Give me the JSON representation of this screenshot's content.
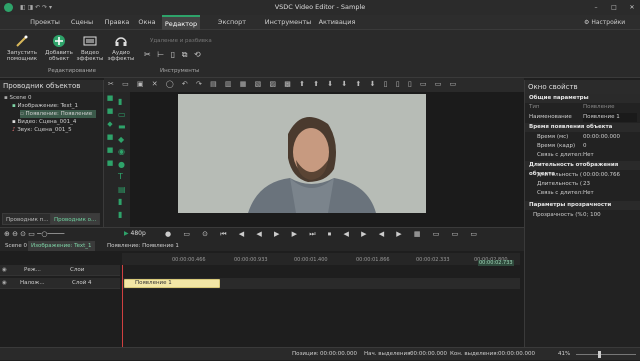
{
  "window": {
    "title": "VSDC Video Editor - Sample",
    "settings_label": "Настройки"
  },
  "menu": [
    {
      "label": "Проекты"
    },
    {
      "label": "Сцены"
    },
    {
      "label": "Правка"
    },
    {
      "label": "Окна"
    },
    {
      "label": "Редактор"
    },
    {
      "label": "Экспорт проекта"
    },
    {
      "label": "Инструменты"
    },
    {
      "label": "Активация"
    }
  ],
  "ribbon": {
    "launch_wizard": "Запустить помощник",
    "add_object": "Добавить объект",
    "video_effects": "Видео эффекты",
    "audio_effects": "Аудио эффекты",
    "group_editing": "Редактирование",
    "tools_label": "Удаление и разбивка",
    "group_tools": "Инструменты"
  },
  "explorer": {
    "title": "Проводник объектов",
    "items": [
      {
        "label": "Scene 0"
      },
      {
        "label": "Изображение: Text_1"
      },
      {
        "label": "Появление: Появление"
      },
      {
        "label": "Видео: Сцена_001_4"
      },
      {
        "label": "Звук: Сцена_001_5"
      }
    ],
    "tabs": [
      {
        "label": "Проводник п..."
      },
      {
        "label": "Проводник о..."
      }
    ]
  },
  "properties": {
    "title": "Окно свойств",
    "general": "Общие параметры",
    "col_name": "Тип",
    "col_value": "Появление",
    "name_label": "Наименование",
    "name_value": "Появление 1",
    "time_section": "Время появления объекта",
    "time_ms_label": "Время (мс)",
    "time_ms_value": "00:00:00.000",
    "time_frame_label": "Время (кадр)",
    "time_frame_value": "0",
    "link_label": "Связь с длител:",
    "link_value": "Нет",
    "duration_section": "Длительность отображения объекта",
    "dur_ms_label": "Длительность (",
    "dur_ms_value": "00:00:00.766",
    "dur_frame_label": "Длительность (",
    "dur_frame_value": "23",
    "link2_label": "Связь с длител:",
    "link2_value": "Нет",
    "transparency_section": "Параметры прозрачности",
    "transparency_label": "Прозрачность (%",
    "transparency_value": "0; 100"
  },
  "player": {
    "resolution": "480p"
  },
  "timeline": {
    "tabs": [
      {
        "label": "Scene 0"
      },
      {
        "label": "Изображение: Text_1"
      },
      {
        "label": "Появление: Появление 1"
      }
    ],
    "header_mode": "Реж...",
    "header_layers": "Слои",
    "track_mode": "Налож...",
    "track_layer": "Слой 4",
    "clip_label": "Появление 1",
    "ruler": [
      "00:00:00.466",
      "00:00:00.933",
      "00:00:01.400",
      "00:00:01.866",
      "00:00:02.333",
      "00:00:02.800"
    ],
    "marker": "00:00:02.733"
  },
  "status": {
    "position_label": "Позиция:",
    "position_value": "00:00:00.000",
    "sel_start_label": "Нач. выделения:",
    "sel_start_value": "00:00:00.000",
    "sel_end_label": "Кон. выделения:",
    "sel_end_value": "00:00:00.000",
    "zoom": "41%"
  },
  "colors": {
    "accent": "#2ea36a",
    "clip": "#f2e6a6"
  }
}
